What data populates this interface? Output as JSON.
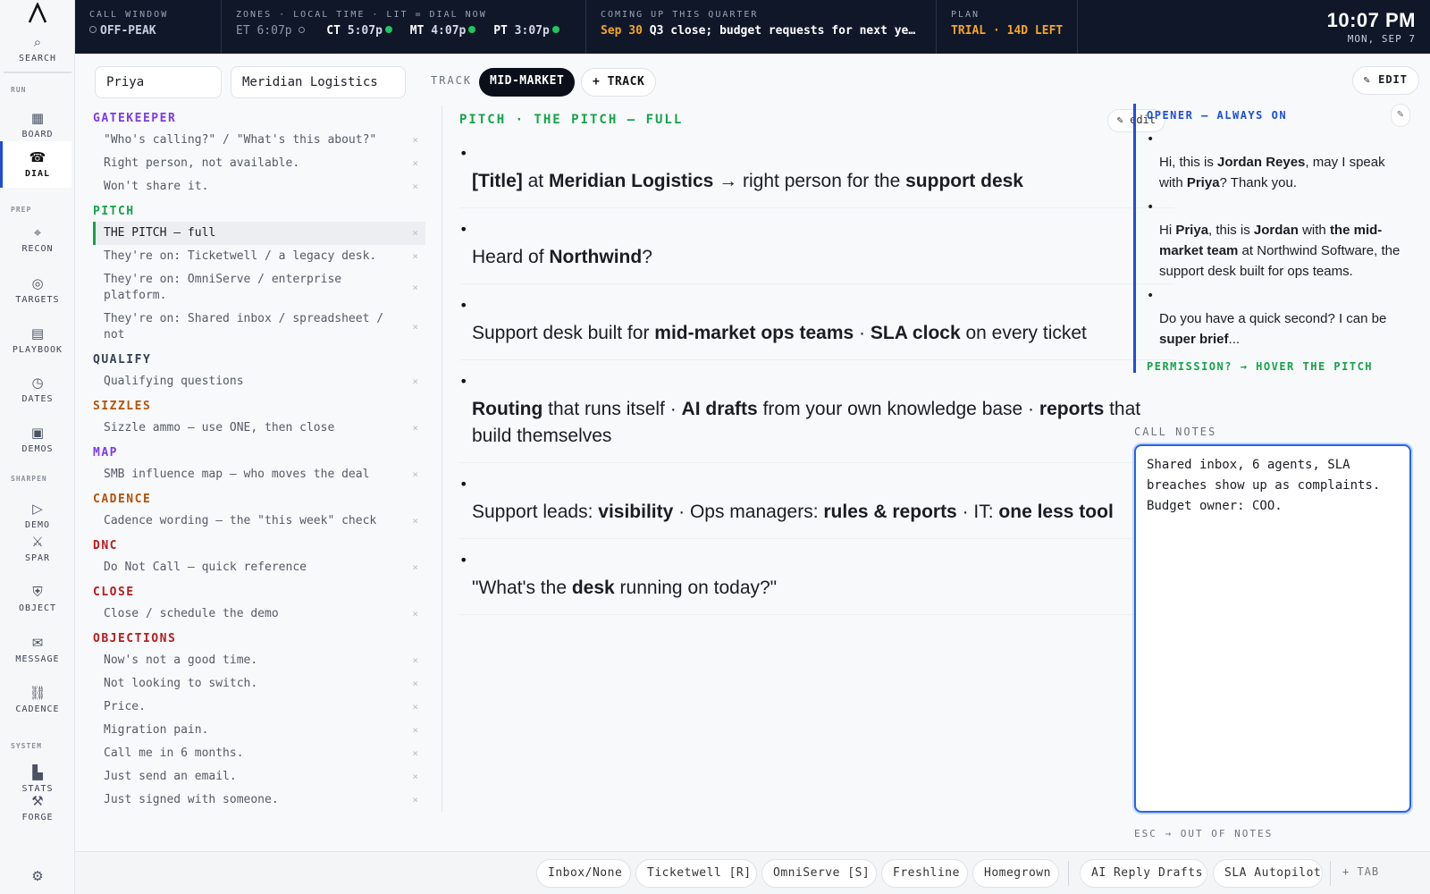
{
  "sidebar": {
    "logo": "A",
    "sections": {
      "run": "RUN",
      "prep": "PREP",
      "sharpen": "SHARPEN",
      "system": "SYSTEM"
    },
    "items": [
      {
        "label": "SEARCH",
        "icon": "⌕"
      },
      {
        "label": "BOARD",
        "icon": "▦"
      },
      {
        "label": "DIAL",
        "icon": "☎"
      },
      {
        "label": "RECON",
        "icon": "⌖"
      },
      {
        "label": "TARGETS",
        "icon": "◎"
      },
      {
        "label": "PLAYBOOK",
        "icon": "▤"
      },
      {
        "label": "DATES",
        "icon": "◷"
      },
      {
        "label": "DEMOS",
        "icon": "▣"
      },
      {
        "label": "DEMO",
        "icon": "▷"
      },
      {
        "label": "SPAR",
        "icon": "⚔"
      },
      {
        "label": "OBJECT",
        "icon": "⛨"
      },
      {
        "label": "MESSAGE",
        "icon": "✉"
      },
      {
        "label": "CADENCE",
        "icon": "⛓"
      },
      {
        "label": "STATS",
        "icon": "▙"
      },
      {
        "label": "FORGE",
        "icon": "⚒"
      },
      {
        "label": "",
        "icon": "⚙"
      }
    ]
  },
  "topbar": {
    "call_window": {
      "label": "CALL WINDOW",
      "value": "OFF-PEAK"
    },
    "zones": {
      "label": "ZONES · LOCAL TIME · LIT = DIAL NOW",
      "et": {
        "code": "ET",
        "time": "6:07p"
      },
      "ct": {
        "code": "CT",
        "time": "5:07p"
      },
      "mt": {
        "code": "MT",
        "time": "4:07p"
      },
      "pt": {
        "code": "PT",
        "time": "3:07p"
      }
    },
    "coming_up": {
      "label": "COMING UP THIS QUARTER",
      "date": "Sep 30",
      "text": "Q3 close; budget requests for next ye…"
    },
    "plan": {
      "label": "PLAN",
      "value": "TRIAL · 14D LEFT"
    },
    "clock": {
      "time": "10:07 PM",
      "date": "MON, SEP 7"
    }
  },
  "context": {
    "contact": "Priya",
    "company": "Meridian Logistics",
    "track_label": "TRACK",
    "track_active": "MID-MARKET",
    "track_add": "+ TRACK",
    "edit": "✎ EDIT"
  },
  "library": {
    "categories": [
      {
        "name": "GATEKEEPER",
        "color": "#7c3aed",
        "items": [
          "\"Who's calling?\" / \"What's this about?\"",
          "Right person, not available.",
          "Won't share it."
        ]
      },
      {
        "name": "PITCH",
        "color": "#16a34a",
        "items": [
          "THE PITCH — full",
          "They're on: Ticketwell / a legacy desk.",
          "They're on: OmniServe / enterprise platform.",
          "They're on: Shared inbox / spreadsheet / not"
        ]
      },
      {
        "name": "QUALIFY",
        "color": "#374151",
        "items": [
          "Qualifying questions"
        ]
      },
      {
        "name": "SIZZLES",
        "color": "#b45309",
        "items": [
          "Sizzle ammo — use ONE, then close"
        ]
      },
      {
        "name": "MAP",
        "color": "#7c3aed",
        "items": [
          "SMB influence map — who moves the deal"
        ]
      },
      {
        "name": "CADENCE",
        "color": "#b45309",
        "items": [
          "Cadence wording — the \"this week\" check"
        ]
      },
      {
        "name": "DNC",
        "color": "#b91c1c",
        "items": [
          "Do Not Call — quick reference"
        ]
      },
      {
        "name": "CLOSE",
        "color": "#b91c1c",
        "items": [
          "Close / schedule the demo"
        ]
      },
      {
        "name": "OBJECTIONS",
        "color": "#b91c1c",
        "items": [
          "Now's not a good time.",
          "Not looking to switch.",
          "Price.",
          "Migration pain.",
          "Call me in 6 months.",
          "Just send an email.",
          "Just signed with someone."
        ]
      }
    ],
    "selected": "THE PITCH — full",
    "remove_icon": "×"
  },
  "pitch": {
    "header": "PITCH · THE PITCH — FULL",
    "edit_label": "✎ edit",
    "bullets": [
      [
        {
          "t": "[Title]",
          "b": true
        },
        {
          "t": " at "
        },
        {
          "t": "Meridian Logistics",
          "b": true
        },
        {
          "t": " → right person for the "
        },
        {
          "t": "support desk",
          "b": true
        }
      ],
      [
        {
          "t": "Heard of "
        },
        {
          "t": "Northwind",
          "b": true
        },
        {
          "t": "?"
        }
      ],
      [
        {
          "t": "Support desk built for "
        },
        {
          "t": "mid-market ops teams",
          "b": true
        },
        {
          "t": " · "
        },
        {
          "t": "SLA clock",
          "b": true
        },
        {
          "t": " on every ticket"
        }
      ],
      [
        {
          "t": "Routing",
          "b": true
        },
        {
          "t": " that runs itself · "
        },
        {
          "t": "AI drafts",
          "b": true
        },
        {
          "t": " from your own knowledge base · "
        },
        {
          "t": "reports",
          "b": true
        },
        {
          "t": " that build themselves"
        }
      ],
      [
        {
          "t": "Support leads: "
        },
        {
          "t": "visibility",
          "b": true
        },
        {
          "t": " · Ops managers: "
        },
        {
          "t": "rules & reports",
          "b": true
        },
        {
          "t": " · IT: "
        },
        {
          "t": "one less tool",
          "b": true
        }
      ],
      [
        {
          "t": "\"What's the "
        },
        {
          "t": "desk",
          "b": true
        },
        {
          "t": " running on today?\""
        }
      ]
    ]
  },
  "opener": {
    "header": "OPENER — ALWAYS ON",
    "pencil": "✎",
    "bullets": [
      [
        {
          "t": "Hi, this is "
        },
        {
          "t": "Jordan Reyes",
          "b": true
        },
        {
          "t": ", may I speak with "
        },
        {
          "t": "Priya",
          "b": true
        },
        {
          "t": "? Thank you."
        }
      ],
      [
        {
          "t": "Hi "
        },
        {
          "t": "Priya",
          "b": true
        },
        {
          "t": ", this is "
        },
        {
          "t": "Jordan",
          "b": true
        },
        {
          "t": " with "
        },
        {
          "t": "the mid-market team",
          "b": true
        },
        {
          "t": " at Northwind Software, the support desk built for ops teams."
        }
      ],
      [
        {
          "t": "Do you have a quick second? I can be "
        },
        {
          "t": "super brief",
          "b": true
        },
        {
          "t": "..."
        }
      ]
    ],
    "footer": "PERMISSION? → HOVER THE PITCH"
  },
  "notes": {
    "label": "CALL NOTES",
    "value": "Shared inbox, 6 agents, SLA breaches show up as complaints. Budget owner: COO.",
    "hint": "ESC → OUT OF NOTES"
  },
  "bottom_tabs": {
    "group1": [
      "Inbox/None",
      "Ticketwell [R]",
      "OmniServe [S]",
      "Freshline",
      "Homegrown"
    ],
    "group2": [
      "AI Reply Drafts",
      "SLA Autopilot"
    ],
    "add": "+ TAB"
  }
}
